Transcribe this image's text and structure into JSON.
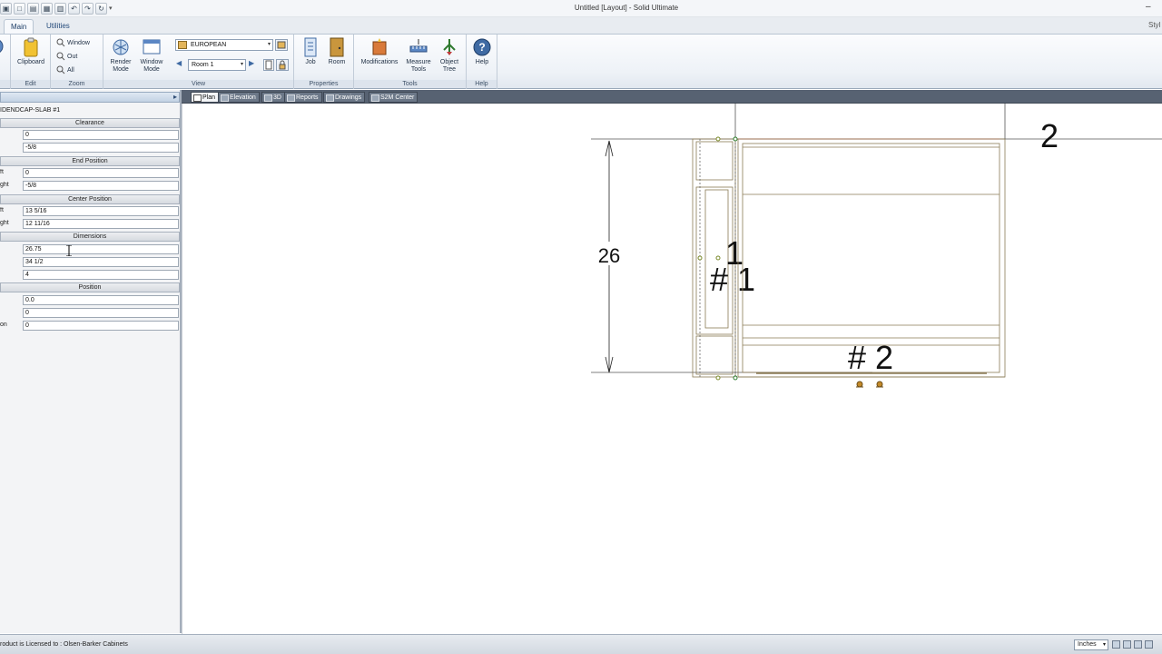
{
  "window": {
    "title": "Untitled [Layout] - Solid Ultimate",
    "styles_link": "Styl"
  },
  "ribbon_tabs": [
    {
      "label": "Main"
    },
    {
      "label": "Utilities"
    }
  ],
  "ribbon": {
    "edit": {
      "group_label": "Edit",
      "clipboard_label": "Clipboard"
    },
    "zoom": {
      "group_label": "Zoom",
      "window_label": "Window",
      "out_label": "Out",
      "all_label": "All"
    },
    "view": {
      "group_label": "View",
      "render_label": "Render Mode",
      "window_mode_label": "Window Mode",
      "style_value": "EUROPEAN",
      "room_value": "Room 1"
    },
    "properties": {
      "group_label": "Properties",
      "job_label": "Job",
      "room_label": "Room"
    },
    "tools": {
      "group_label": "Tools",
      "modifications_label": "Modifications",
      "measure_label": "Measure Tools",
      "object_tree_label": "Object Tree"
    },
    "help": {
      "group_label": "Help",
      "help_label": "Help"
    }
  },
  "panel": {
    "object_title": "IDENDCAP-SLAB #1",
    "sections": {
      "clearance": "Clearance",
      "end_position": "End Position",
      "center_position": "Center Position",
      "dimensions": "Dimensions",
      "position": "Position"
    },
    "rows": {
      "clearance_1": {
        "label": "",
        "value": "0"
      },
      "clearance_2": {
        "label": "",
        "value": "-5/8"
      },
      "end_left": {
        "label": "ft",
        "value": "0"
      },
      "end_right": {
        "label": "ght",
        "value": "-5/8"
      },
      "center_left": {
        "label": "ft",
        "value": "13 5/16"
      },
      "center_right": {
        "label": "ght",
        "value": "12 11/16"
      },
      "dim_1": {
        "label": "",
        "value": "26.75"
      },
      "dim_2": {
        "label": "",
        "value": "34 1/2"
      },
      "dim_3": {
        "label": "",
        "value": "4"
      },
      "pos_1": {
        "label": "",
        "value": "0.0"
      },
      "pos_2": {
        "label": "",
        "value": "0"
      },
      "pos_3": {
        "label": "on",
        "value": "0"
      }
    }
  },
  "doc_tabs": [
    {
      "label": "Plan",
      "active": true
    },
    {
      "label": "Elevation",
      "active": false
    },
    {
      "label": "3D",
      "active": false
    },
    {
      "label": "Reports",
      "active": false
    },
    {
      "label": "Drawings",
      "active": false
    },
    {
      "label": "S2M Center",
      "active": false
    }
  ],
  "drawing": {
    "dimension_value": "26",
    "label_one_a": "1",
    "label_one_b": "# 1",
    "label_two_top": "2",
    "label_two_bottom": "# 2"
  },
  "status": {
    "license_text": "roduct is Licensed to : Olsen-Barker Cabinets",
    "units_value": "Inches"
  },
  "colors": {
    "selection": "#0a246a",
    "drawing_line": "#8a7a55",
    "wall_line": "#d43a3a",
    "dimension_line": "#222222"
  }
}
